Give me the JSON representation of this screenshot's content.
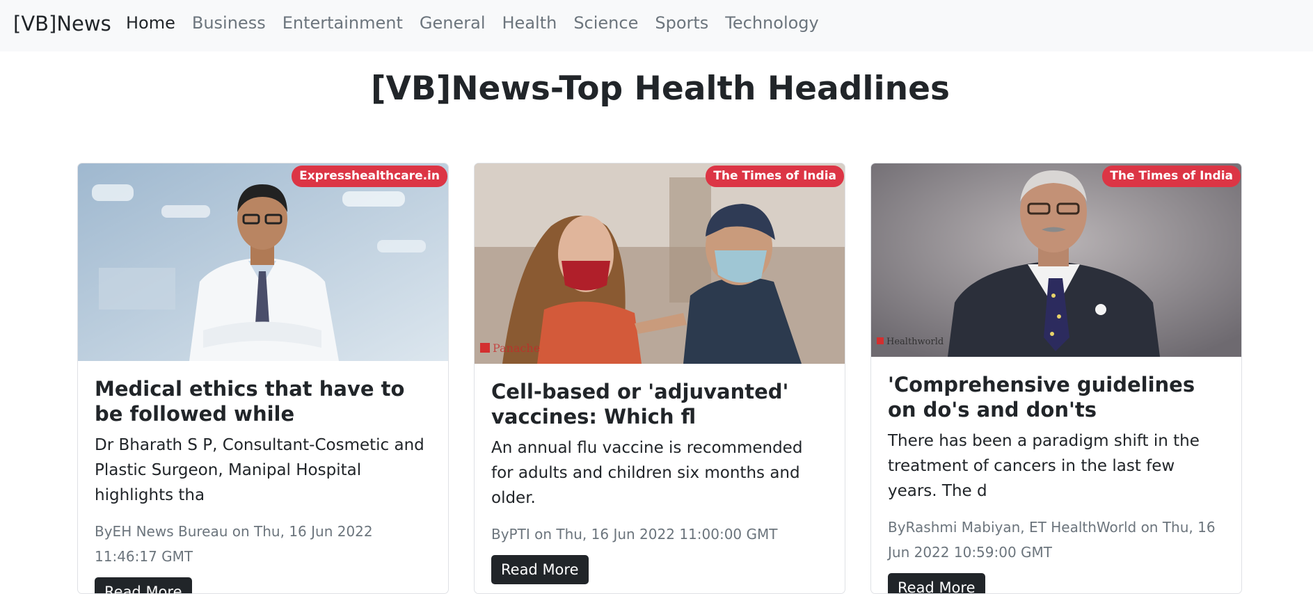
{
  "navbar": {
    "brand": "[VB]News",
    "items": [
      {
        "label": "Home"
      },
      {
        "label": "Business"
      },
      {
        "label": "Entertainment"
      },
      {
        "label": "General"
      },
      {
        "label": "Health"
      },
      {
        "label": "Science"
      },
      {
        "label": "Sports"
      },
      {
        "label": "Technology"
      }
    ],
    "active_label": "Home"
  },
  "page": {
    "title": "[VB]News-Top Health Headlines"
  },
  "articles": [
    {
      "source": "Expresshealthcare.in",
      "title": "Medical ethics that have to be followed while",
      "description": "Dr Bharath S P, Consultant-Cosmetic and Plastic Surgeon, Manipal Hospital highlights tha",
      "meta": "ByEH News Bureau on Thu, 16 Jun 2022 11:46:17 GMT",
      "button": "Read More"
    },
    {
      "source": "The Times of India",
      "title": "Cell-based or 'adjuvanted' vaccines: Which fl",
      "description": "An annual flu vaccine is recommended for adults and children six months and older.",
      "meta": "ByPTI on Thu, 16 Jun 2022 11:00:00 GMT",
      "button": "Read More",
      "image_watermark": "Panache"
    },
    {
      "source": "The Times of India",
      "title": "'Comprehensive guidelines on do's and don'ts",
      "description": "There has been a paradigm shift in the treatment of cancers in the last few years. The d",
      "meta": "ByRashmi Mabiyan, ET HealthWorld on Thu, 16 Jun 2022 10:59:00 GMT",
      "button": "Read More",
      "image_watermark": "Healthworld"
    }
  ],
  "colors": {
    "badge": "#dc3545",
    "navbar_bg": "#f8f9fa",
    "button_bg": "#212529",
    "meta_text": "#6c757d"
  }
}
